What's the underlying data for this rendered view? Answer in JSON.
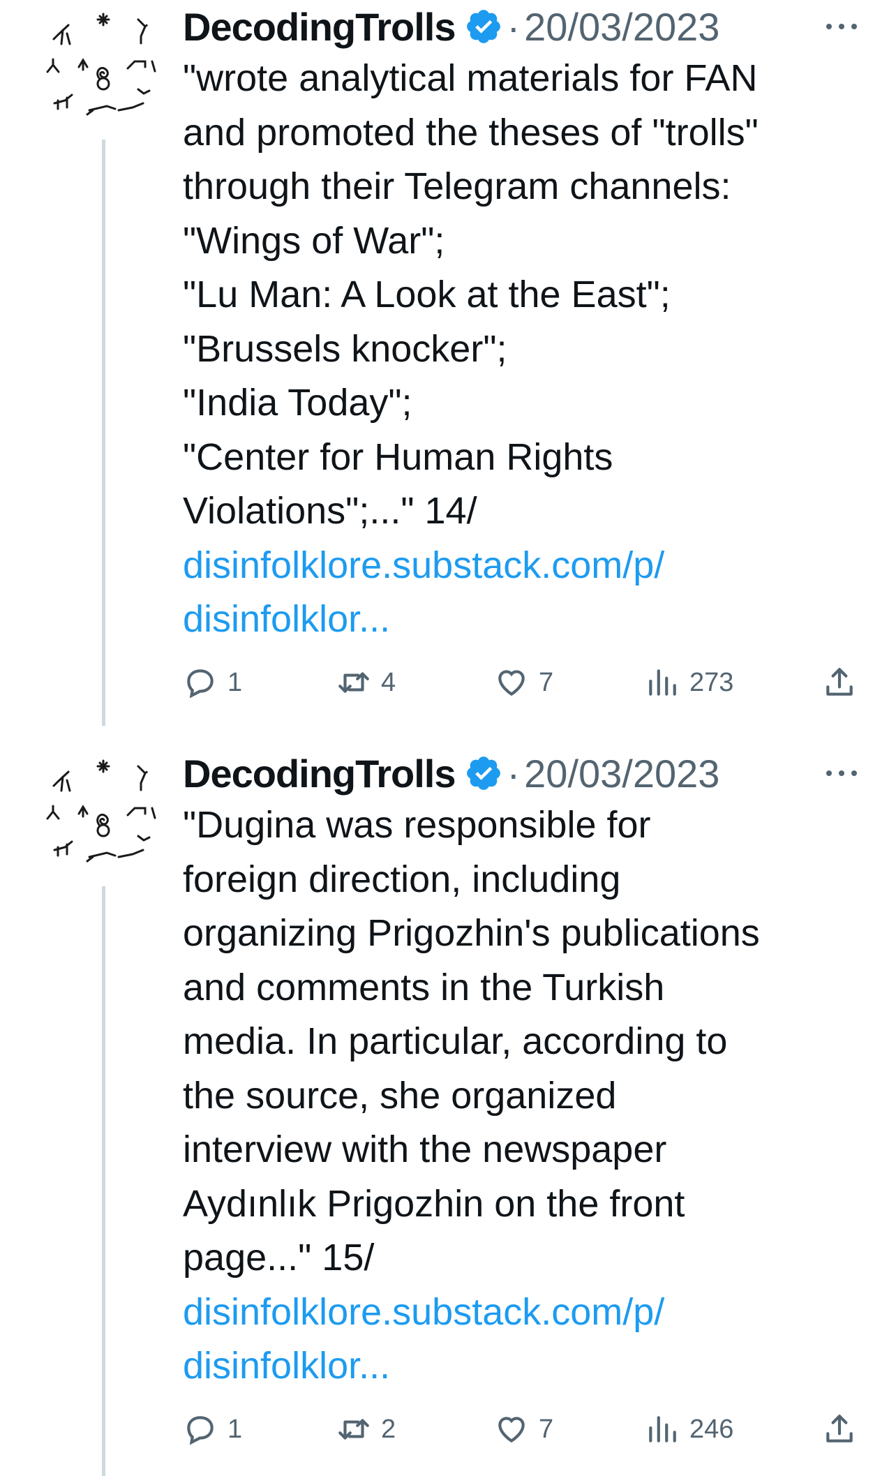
{
  "tweets": [
    {
      "author": "DecodingTrolls",
      "separator": "·",
      "date": "20/03/2023",
      "text_lines": [
        "\"wrote analytical materials for FAN",
        "and promoted the theses of \"trolls\"",
        "through their Telegram channels:",
        "\"Wings of War\";",
        "\"Lu Man: A Look at the East\";",
        "\"Brussels knocker\";",
        "\"India Today\";",
        "\"Center for Human Rights",
        "Violations\";...\" 14/"
      ],
      "link_lines": [
        "disinfolklore.substack.com/p/",
        "disinfolklor..."
      ],
      "replies": "1",
      "retweets": "4",
      "likes": "7",
      "views": "273"
    },
    {
      "author": "DecodingTrolls",
      "separator": "·",
      "date": "20/03/2023",
      "text_lines": [
        "\"Dugina was responsible for",
        "foreign direction, including",
        "organizing Prigozhin's publications",
        "and comments in the Turkish",
        "media. In particular, according to",
        "the source, she organized",
        "interview with the newspaper",
        "Aydınlık Prigozhin on the front",
        "page...\" 15/"
      ],
      "link_lines": [
        "disinfolklore.substack.com/p/",
        "disinfolklor..."
      ],
      "replies": "1",
      "retweets": "2",
      "likes": "7",
      "views": "246"
    }
  ],
  "colors": {
    "accent": "#1d9bf0",
    "muted": "#536471",
    "text": "#0f1419",
    "thread_line": "#cfd9de"
  },
  "icons": [
    "petroglyph-avatar",
    "verified-badge-icon",
    "more-options-icon",
    "reply-icon",
    "retweet-icon",
    "like-icon",
    "views-icon",
    "share-icon"
  ]
}
